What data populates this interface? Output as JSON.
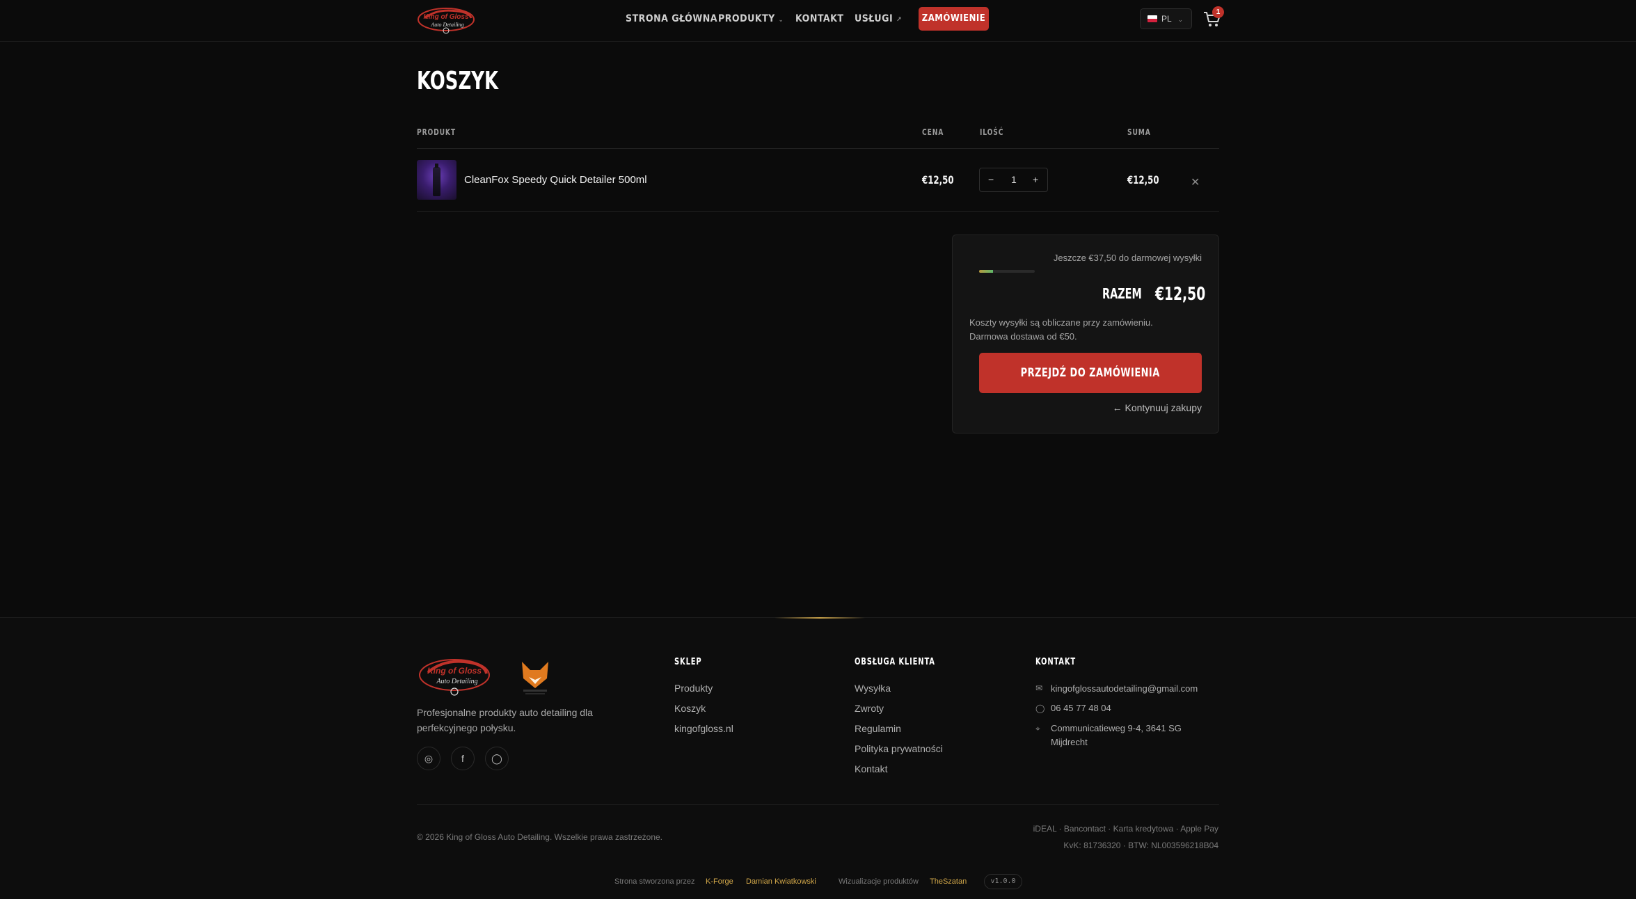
{
  "header": {
    "logo_alt": "King of Gloss Auto Detailing",
    "nav": [
      {
        "label": "STRONA GŁÓWNA"
      },
      {
        "label": "PRODUKTY"
      },
      {
        "label": "KONTAKT"
      },
      {
        "label": "USŁUGI"
      }
    ],
    "order_button": "ZAMÓWIENIE",
    "language": "PL",
    "cart_count": "1"
  },
  "cart": {
    "title": "KOSZYK",
    "columns": {
      "product": "PRODUKT",
      "price": "CENA",
      "quantity": "ILOŚĆ",
      "total": "SUMA"
    },
    "items": [
      {
        "name": "CleanFox Speedy Quick Detailer 500ml",
        "price": "€12,50",
        "quantity": "1",
        "total": "€12,50"
      }
    ]
  },
  "summary": {
    "free_shipping_message": "Jeszcze €37,50 do darmowej wysyłki",
    "free_shipping_progress": 0.25,
    "total_label": "RAZEM",
    "total_value": "€12,50",
    "note_line1": "Koszty wysyłki są obliczane przy zamówieniu.",
    "note_line2": "Darmowa dostawa od €50.",
    "checkout_button": "PRZEJDŹ DO ZAMÓWIENIA",
    "continue_link": "← Kontynuuj zakupy"
  },
  "footer": {
    "tagline": "Profesjonalne produkty auto detailing dla perfekcyjnego połysku.",
    "shop": {
      "heading": "SKLEP",
      "links": [
        "Produkty",
        "Koszyk",
        "kingofgloss.nl"
      ]
    },
    "service": {
      "heading": "OBSŁUGA KLIENTA",
      "links": [
        "Wysyłka",
        "Zwroty",
        "Regulamin",
        "Polityka prywatności",
        "Kontakt"
      ]
    },
    "contact": {
      "heading": "KONTAKT",
      "email": "kingofglossautodetailing@gmail.com",
      "phone": "06 45 77 48 04",
      "address_line1": "Communicatieweg 9-4, 3641 SG",
      "address_line2": "Mijdrecht"
    },
    "copyright": "© 2026 King of Gloss Auto Detailing. Wszelkie prawa zastrzeżone.",
    "payments": "iDEAL · Bancontact · Karta kredytowa · Apple Pay",
    "kvk": "KvK: 81736320 · BTW: NL003596218B04",
    "credits": {
      "made_by_label": "Strona stworzona przez",
      "made_by_brand": "K-Forge",
      "author": "Damian Kwiatkowski",
      "visuals_label": "Wizualizacje produktów",
      "visuals_brand": "TheSzatan",
      "version": "v1.0.0"
    }
  },
  "colors": {
    "accent": "#c0322a",
    "gold": "#d4a94a",
    "background": "#0b0b0b"
  }
}
